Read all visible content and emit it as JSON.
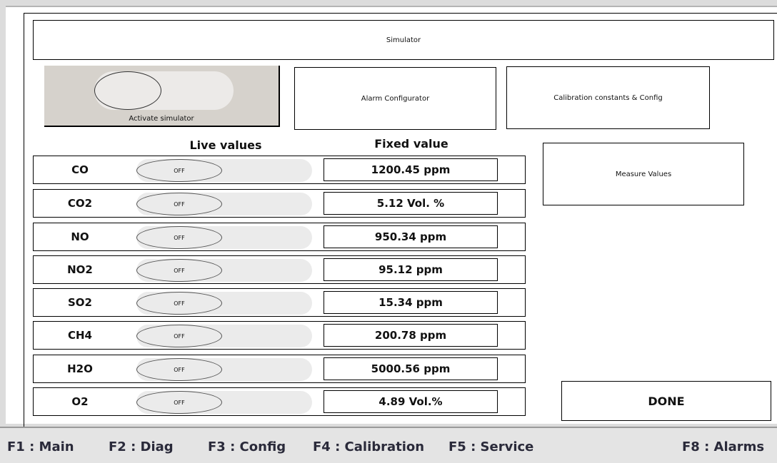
{
  "header": {
    "title": "Simulator"
  },
  "activate": {
    "label": "Activate simulator"
  },
  "buttons": {
    "alarm_config": "Alarm Configurator",
    "calibration": "Calibration constants & Config",
    "measure_values": "Measure Values",
    "done": "DONE"
  },
  "columns": {
    "live": "Live values",
    "fixed": "Fixed value"
  },
  "rows": [
    {
      "name": "CO",
      "toggle": "OFF",
      "value": "1200.45 ppm"
    },
    {
      "name": "CO2",
      "toggle": "OFF",
      "value": "5.12 Vol. %"
    },
    {
      "name": "NO",
      "toggle": "OFF",
      "value": "950.34 ppm"
    },
    {
      "name": "NO2",
      "toggle": "OFF",
      "value": "95.12 ppm"
    },
    {
      "name": "SO2",
      "toggle": "OFF",
      "value": "15.34 ppm"
    },
    {
      "name": "CH4",
      "toggle": "OFF",
      "value": "200.78 ppm"
    },
    {
      "name": "H2O",
      "toggle": "OFF",
      "value": "5000.56 ppm"
    },
    {
      "name": "O2",
      "toggle": "OFF",
      "value": "4.89 Vol.%"
    }
  ],
  "fkeys": [
    {
      "label": "F1 : Main"
    },
    {
      "label": "F2 : Diag"
    },
    {
      "label": "F3 : Config"
    },
    {
      "label": "F4 : Calibration"
    },
    {
      "label": "F5 : Service"
    },
    {
      "label": "F8 : Alarms"
    }
  ],
  "colors": {
    "panel_bg": "#ffffff",
    "activate_bg": "#d6d2cc",
    "fbar_bg": "#e4e4e4",
    "toggle_bg": "#ebebeb"
  }
}
